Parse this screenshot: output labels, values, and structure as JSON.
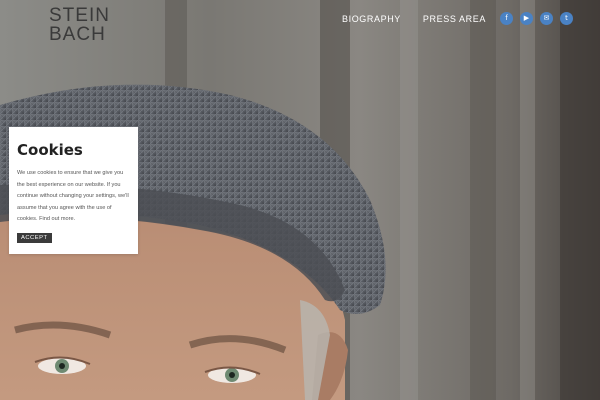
{
  "header": {
    "logo_line1": "STEIN",
    "logo_line2": "BACH",
    "nav": [
      {
        "label": "BIOGRAPHY"
      },
      {
        "label": "PRESS AREA"
      }
    ],
    "social": [
      {
        "icon": "facebook-icon",
        "glyph": "f"
      },
      {
        "icon": "youtube-icon",
        "glyph": "▶"
      },
      {
        "icon": "mail-icon",
        "glyph": "✉"
      },
      {
        "icon": "twitter-icon",
        "glyph": "t"
      }
    ],
    "social_color": "#4a82c4"
  },
  "cookie": {
    "title": "Cookies",
    "text": "We use cookies to ensure that we give you the best experience on our website. If you continue without changing your settings, we'll assume that you agree with the use of cookies.",
    "link": "Find out more.",
    "accept": "ACCEPT"
  },
  "colors": {
    "button_dark": "#3b3b3b",
    "logo": "#3a3a3a"
  }
}
